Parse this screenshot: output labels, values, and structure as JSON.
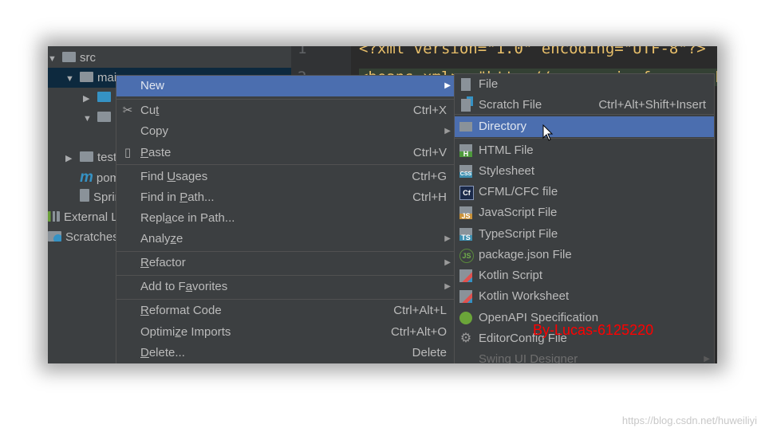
{
  "tree": [
    {
      "label": "src",
      "indent": 0,
      "arrow": "▼",
      "icon": "folder-icon"
    },
    {
      "label": "main",
      "indent": 1,
      "arrow": "▼",
      "icon": "folder-icon",
      "selected": true
    },
    {
      "label": "",
      "indent": 2,
      "arrow": "▶",
      "icon": "source-folder-icon"
    },
    {
      "label": "",
      "indent": 2,
      "arrow": "▼",
      "icon": "resources-folder-icon"
    },
    {
      "label": "test",
      "indent": 1,
      "arrow": "▶",
      "icon": "folder-icon"
    },
    {
      "label": "pom.xml",
      "indent": 1,
      "arrow": "",
      "icon": "maven-icon"
    },
    {
      "label": "Spring",
      "indent": 1,
      "arrow": "",
      "icon": "file-icon"
    },
    {
      "label": "External Libraries",
      "indent": 0,
      "arrow": "",
      "icon": "library-icon"
    },
    {
      "label": "Scratches and Consoles",
      "indent": 0,
      "arrow": "",
      "icon": "scratch-icon"
    }
  ],
  "editor": {
    "line_numbers": [
      "1",
      "2"
    ],
    "line1": "<?xml version=\"1.0\" encoding=\"UTF-8\"?>",
    "line2": "<beans xmlns=\"http://www.springframework.org/\""
  },
  "context_menu": [
    {
      "label": "New",
      "submenu": true,
      "selected": true
    },
    {
      "label": "Cut",
      "shortcut": "Ctrl+X",
      "mnemonic": "t",
      "icon": "scissors-icon"
    },
    {
      "label": "Copy",
      "submenu": true
    },
    {
      "label": "Paste",
      "shortcut": "Ctrl+V",
      "mnemonic": "P",
      "icon": "clipboard-icon"
    },
    {
      "label": "Find Usages",
      "shortcut": "Ctrl+G",
      "mnemonic": "U"
    },
    {
      "label": "Find in Path...",
      "shortcut": "Ctrl+H",
      "mnemonic": "P"
    },
    {
      "label": "Replace in Path...",
      "mnemonic": "a"
    },
    {
      "label": "Analyze",
      "submenu": true,
      "mnemonic": "z"
    },
    {
      "label": "Refactor",
      "submenu": true,
      "mnemonic": "R"
    },
    {
      "label": "Add to Favorites",
      "submenu": true,
      "mnemonic": "a"
    },
    {
      "label": "Reformat Code",
      "shortcut": "Ctrl+Alt+L",
      "mnemonic": "R"
    },
    {
      "label": "Optimize Imports",
      "shortcut": "Ctrl+Alt+O",
      "mnemonic": "z"
    },
    {
      "label": "Delete...",
      "shortcut": "Delete",
      "mnemonic": "D"
    }
  ],
  "new_submenu": [
    {
      "label": "File",
      "icon": "file-icon"
    },
    {
      "label": "Scratch File",
      "shortcut": "Ctrl+Alt+Shift+Insert",
      "icon": "scratch-file-icon"
    },
    {
      "label": "Directory",
      "icon": "folder-icon",
      "selected": true
    },
    {
      "label": "HTML File",
      "icon": "html-file-icon",
      "badge": "H",
      "color": "#4e9a3c"
    },
    {
      "label": "Stylesheet",
      "icon": "css-file-icon",
      "badge": "CSS",
      "color": "#3e8fb0"
    },
    {
      "label": "CFML/CFC file",
      "icon": "cfml-icon",
      "badge": "Cf",
      "color": "#1b2a4a"
    },
    {
      "label": "JavaScript File",
      "icon": "js-file-icon",
      "badge": "JS",
      "color": "#c9923a"
    },
    {
      "label": "TypeScript File",
      "icon": "ts-file-icon",
      "badge": "TS",
      "color": "#3e8fb0"
    },
    {
      "label": "package.json File",
      "icon": "nodejs-icon",
      "badge": "JS",
      "color": "#3c6e3c"
    },
    {
      "label": "Kotlin Script",
      "icon": "kotlin-icon",
      "color": "#e0524f"
    },
    {
      "label": "Kotlin Worksheet",
      "icon": "kotlin-icon",
      "color": "#e0524f"
    },
    {
      "label": "OpenAPI Specification",
      "icon": "openapi-icon",
      "color": "#6ba539"
    },
    {
      "label": "EditorConfig File",
      "icon": "gear-icon"
    },
    {
      "label": "Swing UI Designer",
      "submenu": true,
      "disabled": true
    }
  ],
  "overlay_text": "By-Lucas-6125220",
  "watermark": "https://blog.csdn.net/huweiliyi",
  "colors": {
    "selection": "#4b6eaf",
    "menu_bg": "#3c3f41",
    "overlay": "#ff0000"
  }
}
